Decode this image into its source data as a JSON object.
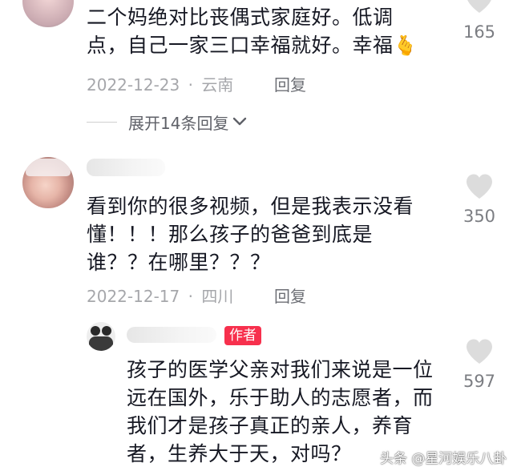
{
  "comments": [
    {
      "text_lines": [
        "二个妈绝对比丧偶式家庭好。低调",
        "点，自己一家三口幸福就好。幸福"
      ],
      "emoji": "🫰",
      "date": "2022-12-23",
      "location": "云南",
      "reply_label": "回复",
      "like_count": "165",
      "expand_label": "展开14条回复"
    },
    {
      "text_lines": [
        "看到你的很多视频，但是我表示没看",
        "懂！！！那么孩子的爸爸到底是",
        "谁？？在哪里？？？"
      ],
      "date": "2022-12-17",
      "location": "四川",
      "reply_label": "回复",
      "like_count": "350"
    }
  ],
  "author_reply": {
    "badge": "作者",
    "text_lines": [
      "孩子的医学父亲对我们来说是一位",
      "远在国外，乐于助人的志愿者，而",
      "我们才是孩子真正的亲人，养育",
      "者，生养大于天，对吗？"
    ],
    "like_count": "597"
  },
  "separator": "·",
  "watermark": "头条 @星河娱乐八卦",
  "colors": {
    "badge": "#f7304d",
    "heart": "#dcdcdc",
    "meta": "#a6a7ab"
  }
}
